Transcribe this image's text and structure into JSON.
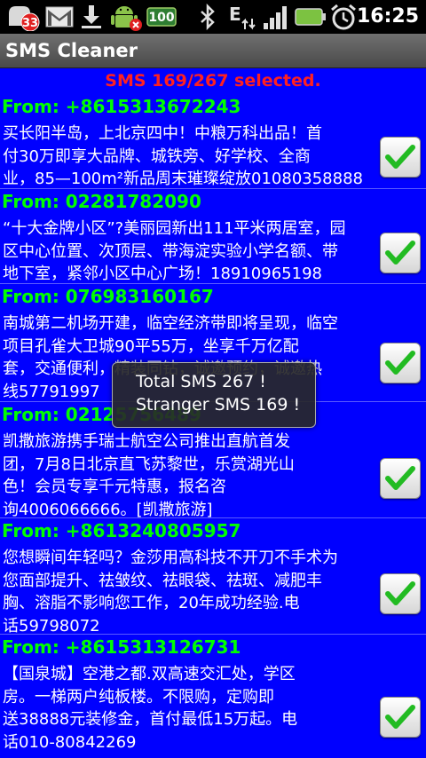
{
  "status_bar": {
    "notification_count": "33",
    "battery_percent": "100",
    "network_type": "E",
    "time": "16:25",
    "icons": [
      "badge-icon",
      "gmail-icon",
      "download-icon",
      "android-icon",
      "battery-100-badge",
      "bluetooth-icon",
      "edge-network-icon",
      "signal-icon",
      "battery-icon",
      "alarm-icon"
    ]
  },
  "app": {
    "title": "SMS Cleaner"
  },
  "selection_text": "SMS 169/267 selected.",
  "messages": [
    {
      "from": "From: +8615313672243",
      "body": "买长阳半岛，上北京四中！中粮万科出品！首\n付30万即享大品牌、城铁旁、好学校、全商\n业，85—100m²新品周末璀璨绽放01080358888",
      "checked": true
    },
    {
      "from": "From: 02281782090",
      "body": "“十大金牌小区”?美丽园新出111平米两居室，园\n区中心位置、次顶层、带海淀实验小学名额、带\n地下室，紧邻小区中心广场！18910965198",
      "checked": true
    },
    {
      "from": "From: 076983160167",
      "body": "南城第二机场开建，临空经济带即将呈现，临空\n项目孔雀大卫城90平55万，坐享千万亿配\n套，交通便利，精装同钻，诚邀预约，诚邀热\n线57791997",
      "checked": true
    },
    {
      "from": "From: 02125756489",
      "body": "凯撒旅游携手瑞士航空公司推出直航首发\n团，7月8日北京直飞苏黎世，乐赏湖光山\n色！会员专享千元特惠，报名咨\n询4006066666。[凯撒旅游]",
      "checked": true
    },
    {
      "from": "From: +8613240805957",
      "body": "您想瞬间年轻吗？金莎用高科技不开刀不手术为\n您面部提升、祛皱纹、祛眼袋、祛斑、减肥丰\n胸、溶脂不影响您工作，20年成功经验.电\n话59798072",
      "checked": true
    },
    {
      "from": "From: +8615313126731",
      "body": "【国泉城】空港之都.双高速交汇处，学区\n房。一梯两户纯板楼。不限购，定购即\n送38888元装修金，首付最低15万起。电\n话010-80842269",
      "checked": true
    }
  ],
  "toast": {
    "line1": "Total SMS 267 !",
    "line2": "Stranger SMS 169 !"
  },
  "colors": {
    "background": "#0000ff",
    "from": "#00ff00",
    "selection": "#ff2020",
    "check": "#22bb22"
  }
}
